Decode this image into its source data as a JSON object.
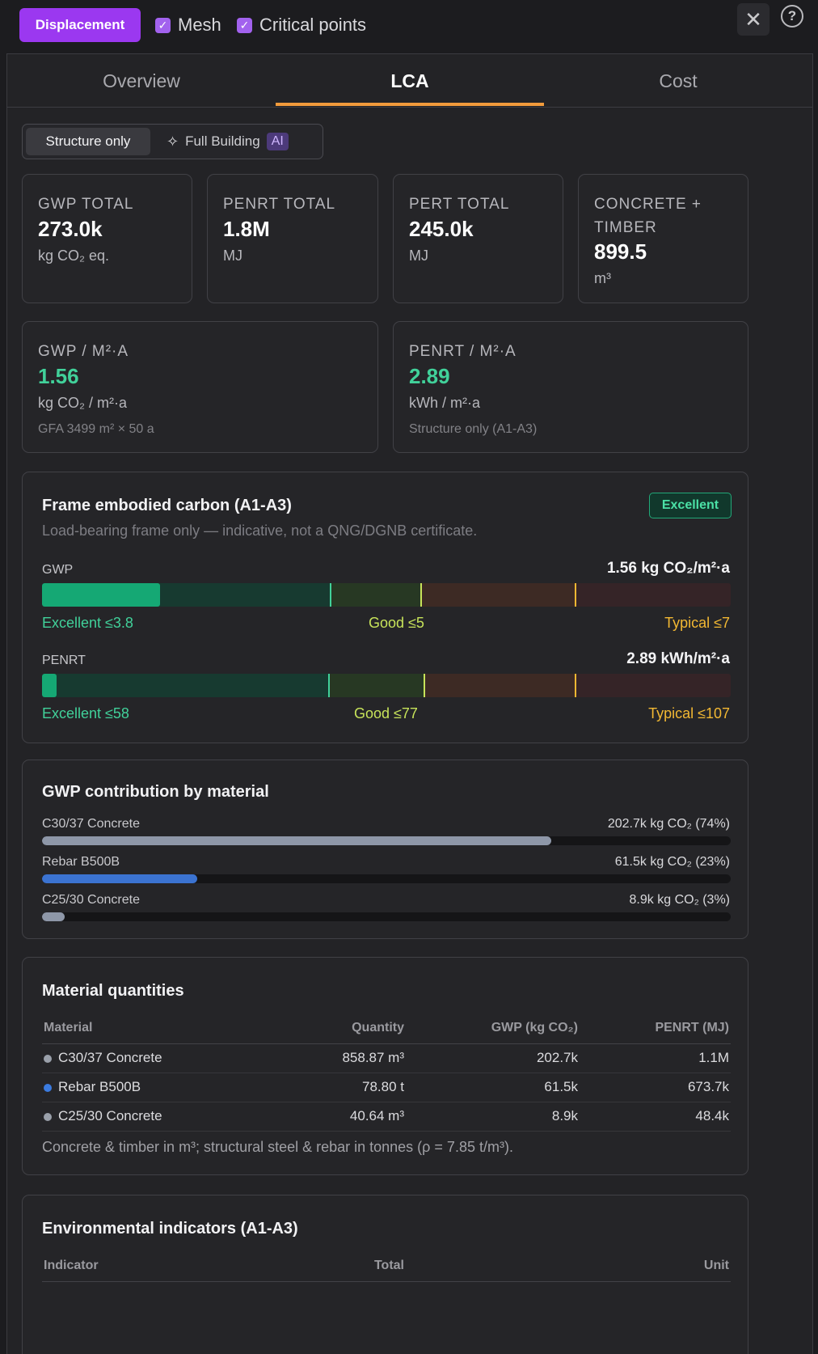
{
  "toolbar": {
    "displacement_label": "Displacement",
    "mesh_label": "Mesh",
    "critical_points_label": "Critical points",
    "close_glyph": "✕",
    "help_glyph": "?"
  },
  "tabs": [
    {
      "label": "Overview",
      "active": false
    },
    {
      "label": "LCA",
      "active": true
    },
    {
      "label": "Cost",
      "active": false
    }
  ],
  "scope": {
    "structure_only": "Structure only",
    "full_building": "Full Building",
    "ai_badge": "AI"
  },
  "kpis": [
    {
      "label": "GWP TOTAL",
      "value": "273.0k",
      "unit": "kg CO₂ eq."
    },
    {
      "label": "PENRT TOTAL",
      "value": "1.8M",
      "unit": "MJ"
    },
    {
      "label": "PERT TOTAL",
      "value": "245.0k",
      "unit": "MJ"
    },
    {
      "label": "CONCRETE + TIMBER",
      "value": "899.5",
      "unit": "m³"
    }
  ],
  "intensity": [
    {
      "label": "GWP / M²·A",
      "value": "1.56",
      "unit": "kg CO₂ / m²·a",
      "sub": "GFA 3499 m² × 50 a"
    },
    {
      "label": "PENRT / M²·A",
      "value": "2.89",
      "unit": "kWh / m²·a",
      "sub": "Structure only (A1-A3)"
    }
  ],
  "frame": {
    "title": "Frame embodied carbon (A1-A3)",
    "subtitle": "Load-bearing frame only — indicative, not a QNG/DGNB certificate.",
    "rating": "Excellent",
    "colors": {
      "excellent": "#41d19a",
      "good": "#c7e35a",
      "typical": "#f2b833"
    },
    "bars": [
      {
        "label": "GWP",
        "value_text": "1.56 kg CO₂/m²·a",
        "value": 1.56,
        "excellent_text": "Excellent ≤3.8",
        "good_text": "Good ≤5",
        "typical_text": "Typical ≤7",
        "fill_fraction": 0.171,
        "thresholds": [
          0.419,
          0.551,
          0.775
        ]
      },
      {
        "label": "PENRT",
        "value_text": "2.89 kWh/m²·a",
        "value": 2.89,
        "excellent_text": "Excellent ≤58",
        "good_text": "Good ≤77",
        "typical_text": "Typical ≤107",
        "fill_fraction": 0.02,
        "thresholds": [
          0.417,
          0.555,
          0.775
        ]
      }
    ]
  },
  "gwp_by_material": {
    "title": "GWP contribution by material",
    "items": [
      {
        "label": "C30/37 Concrete",
        "value_text": "202.7k kg CO₂ (74%)",
        "fraction": 0.74,
        "color": "#8e97a8"
      },
      {
        "label": "Rebar B500B",
        "value_text": "61.5k kg CO₂ (23%)",
        "fraction": 0.225,
        "color": "#3b73d1"
      },
      {
        "label": "C25/30 Concrete",
        "value_text": "8.9k kg CO₂ (3%)",
        "fraction": 0.033,
        "color": "#8e97a8"
      }
    ]
  },
  "quantities": {
    "title": "Material quantities",
    "headers": [
      "Material",
      "Quantity",
      "GWP (kg CO₂)",
      "PENRT (MJ)"
    ],
    "rows": [
      {
        "material": "C30/37 Concrete",
        "quantity": "858.87 m³",
        "gwp": "202.7k",
        "penrt": "1.1M",
        "color": "#9aa0aa"
      },
      {
        "material": "Rebar B500B",
        "quantity": "78.80 t",
        "gwp": "61.5k",
        "penrt": "673.7k",
        "color": "#3b7be0"
      },
      {
        "material": "C25/30 Concrete",
        "quantity": "40.64 m³",
        "gwp": "8.9k",
        "penrt": "48.4k",
        "color": "#9aa0aa"
      }
    ],
    "note": "Concrete & timber in m³; structural steel & rebar in tonnes (ρ = 7.85 t/m³)."
  },
  "environmental": {
    "title": "Environmental indicators (A1-A3)",
    "headers": [
      "Indicator",
      "Total",
      "Unit"
    ]
  }
}
